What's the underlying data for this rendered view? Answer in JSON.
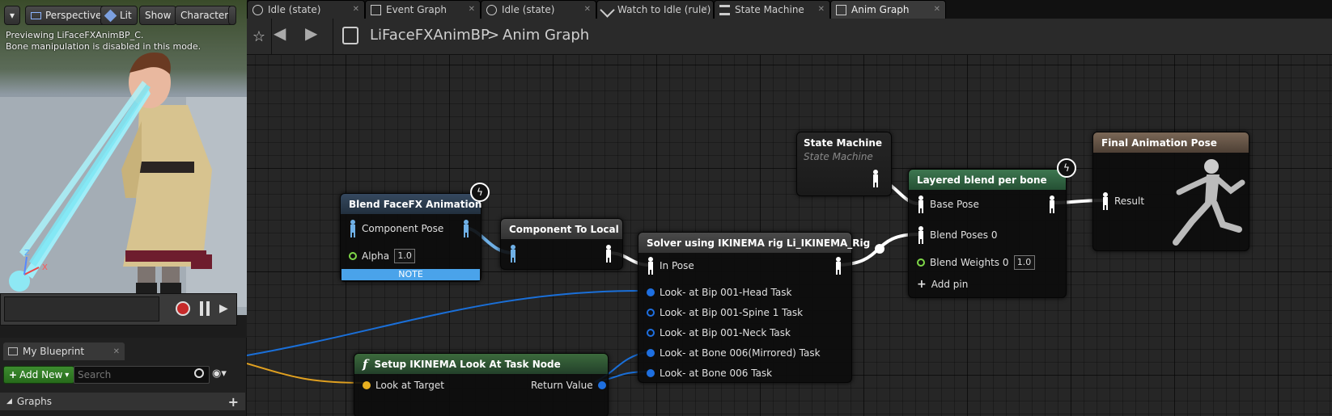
{
  "viewport": {
    "buttons": [
      {
        "label": ""
      },
      {
        "label": "Perspective"
      },
      {
        "label": "Lit"
      },
      {
        "label": "Show"
      },
      {
        "label": "Character"
      }
    ],
    "preview_lines": [
      "Previewing LiFaceFXAnimBP_C.",
      "Bone manipulation is disabled in this mode."
    ],
    "axis": {
      "x": "X",
      "z": "Z"
    }
  },
  "tabs": [
    {
      "label": "Idle (state)",
      "icon": "state-icon"
    },
    {
      "label": "Event Graph",
      "icon": "graph-icon"
    },
    {
      "label": "Idle (state)",
      "icon": "state-icon"
    },
    {
      "label": "Watch to Idle (rule)",
      "icon": "rule-icon"
    },
    {
      "label": "State Machine",
      "icon": "state-machine-icon"
    },
    {
      "label": "Anim Graph",
      "icon": "graph-icon"
    }
  ],
  "breadcrumb": {
    "blueprint": "LiFaceFXAnimBP",
    "separator": ">",
    "graph": "Anim Graph"
  },
  "left_panel": {
    "tab_label": "My Blueprint",
    "add_new_label": "Add New",
    "search_placeholder": "Search",
    "section_label": "Graphs"
  },
  "nodes": {
    "blend_facefx": {
      "title": "Blend FaceFX Animation",
      "pin_component_pose": "Component Pose",
      "pin_alpha": "Alpha",
      "alpha_value": "1.0",
      "note": "NOTE",
      "color": "#2d3d4f"
    },
    "component_to_local": {
      "title": "Component To Local",
      "color": "#3a3a3a"
    },
    "solver": {
      "title": "Solver using IKINEMA rig Li_IKINEMA_Rig",
      "pin_in_pose": "In Pose",
      "lookats": [
        "Look- at  Bip 001-Head Task",
        "Look- at  Bip 001-Spine 1 Task",
        "Look- at  Bip 001-Neck Task",
        "Look- at  Bone 006(Mirrored) Task",
        "Look- at  Bone 006 Task"
      ]
    },
    "setup_ikinema": {
      "title": "Setup IKINEMA Look At Task Node",
      "pin_look_at": "Look at Target",
      "pin_return": "Return Value",
      "color": "#2f5130"
    },
    "state_machine": {
      "title": "State Machine",
      "subtitle": "State Machine"
    },
    "layered_blend": {
      "title": "Layered blend per bone",
      "pin_base": "Base Pose",
      "pin_blend_poses": "Blend Poses 0",
      "pin_blend_weights": "Blend Weights 0",
      "weights_value": "1.0",
      "add_pin": "Add pin",
      "color": "#2f5b3c"
    },
    "final_pose": {
      "title": "Final Animation Pose",
      "pin_result": "Result",
      "color": "#6a5a4c"
    }
  },
  "colors": {
    "pose_wire": "#ffffff",
    "exec_wire": "#1a6fd8",
    "float_wire": "#e0a020",
    "accent_green": "#7fd848"
  }
}
